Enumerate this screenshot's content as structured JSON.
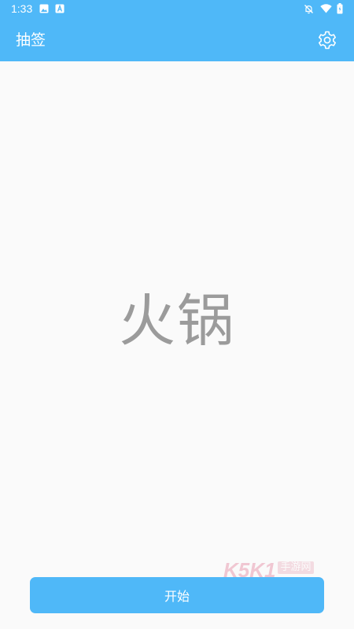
{
  "status_bar": {
    "time": "1:33",
    "left_icons": [
      "image-notification-icon",
      "a-notification-icon"
    ],
    "right_icons": [
      "bell-off-icon",
      "wifi-icon",
      "battery-icon"
    ]
  },
  "app_bar": {
    "title": "抽签",
    "settings_icon": "gear-icon"
  },
  "main": {
    "result_text": "火锅"
  },
  "watermark": {
    "letters": "K5K1",
    "cn_text": "手游网"
  },
  "actions": {
    "start_label": "开始"
  },
  "colors": {
    "primary": "#4fb8f8",
    "background": "#fafafa",
    "result_text": "#9b9b9b"
  }
}
